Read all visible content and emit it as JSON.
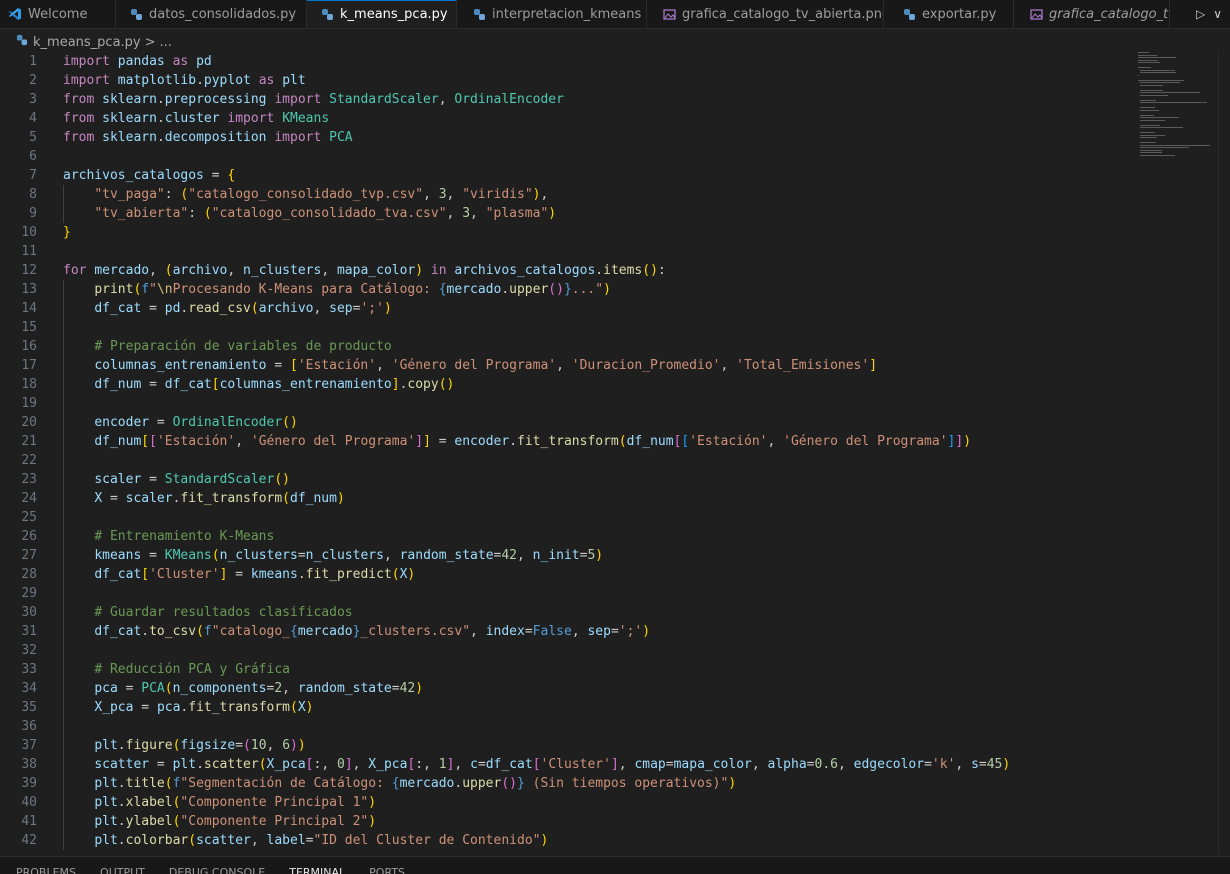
{
  "tabs": [
    {
      "label": "Welcome",
      "icon": "vscode-logo-icon"
    },
    {
      "label": "datos_consolidados.py",
      "icon": "python-icon"
    },
    {
      "label": "k_means_pca.py",
      "icon": "python-icon",
      "active": true,
      "close": "×"
    },
    {
      "label": "interpretacion_kmeans",
      "icon": "python-icon"
    },
    {
      "label": "grafica_catalogo_tv_abierta.png",
      "icon": "image-icon"
    },
    {
      "label": "exportar.py",
      "icon": "python-icon"
    },
    {
      "label": "grafica_catalogo_tv_p",
      "icon": "image-icon",
      "italic": true
    }
  ],
  "breadcrumb": {
    "file": "k_means_pca.py",
    "sep": ">",
    "rest": "..."
  },
  "tab_actions": {
    "run": "▷",
    "dropdown": "∨"
  },
  "panel": {
    "tabs": [
      "PROBLEMS",
      "OUTPUT",
      "DEBUG CONSOLE",
      "TERMINAL",
      "PORTS"
    ],
    "active": "TERMINAL"
  },
  "code": [
    {
      "n": "1",
      "t": "import pandas as pd"
    },
    {
      "n": "2",
      "t": "import matplotlib.pyplot as plt"
    },
    {
      "n": "3",
      "t": "from sklearn.preprocessing import StandardScaler, OrdinalEncoder"
    },
    {
      "n": "4",
      "t": "from sklearn.cluster import KMeans"
    },
    {
      "n": "5",
      "t": "from sklearn.decomposition import PCA"
    },
    {
      "n": "6",
      "t": ""
    },
    {
      "n": "7",
      "t": "archivos_catalogos = {"
    },
    {
      "n": "8",
      "t": "    \"tv_paga\": (\"catalogo_consolidado_tvp.csv\", 3, \"viridis\"),"
    },
    {
      "n": "9",
      "t": "    \"tv_abierta\": (\"catalogo_consolidado_tva.csv\", 3, \"plasma\")"
    },
    {
      "n": "10",
      "t": "}"
    },
    {
      "n": "11",
      "t": ""
    },
    {
      "n": "12",
      "t": "for mercado, (archivo, n_clusters, mapa_color) in archivos_catalogos.items():"
    },
    {
      "n": "13",
      "t": "    print(f\"\\nProcesando K-Means para Catálogo: {mercado.upper()}...\")"
    },
    {
      "n": "14",
      "t": "    df_cat = pd.read_csv(archivo, sep=';')"
    },
    {
      "n": "15",
      "t": ""
    },
    {
      "n": "16",
      "t": "    # Preparación de variables de producto"
    },
    {
      "n": "17",
      "t": "    columnas_entrenamiento = ['Estación', 'Género del Programa', 'Duracion_Promedio', 'Total_Emisiones']"
    },
    {
      "n": "18",
      "t": "    df_num = df_cat[columnas_entrenamiento].copy()"
    },
    {
      "n": "19",
      "t": ""
    },
    {
      "n": "20",
      "t": "    encoder = OrdinalEncoder()"
    },
    {
      "n": "21",
      "t": "    df_num[['Estación', 'Género del Programa']] = encoder.fit_transform(df_num[['Estación', 'Género del Programa']])"
    },
    {
      "n": "22",
      "t": ""
    },
    {
      "n": "23",
      "t": "    scaler = StandardScaler()"
    },
    {
      "n": "24",
      "t": "    X = scaler.fit_transform(df_num)"
    },
    {
      "n": "25",
      "t": ""
    },
    {
      "n": "26",
      "t": "    # Entrenamiento K-Means"
    },
    {
      "n": "27",
      "t": "    kmeans = KMeans(n_clusters=n_clusters, random_state=42, n_init=5)"
    },
    {
      "n": "28",
      "t": "    df_cat['Cluster'] = kmeans.fit_predict(X)"
    },
    {
      "n": "29",
      "t": ""
    },
    {
      "n": "30",
      "t": "    # Guardar resultados clasificados"
    },
    {
      "n": "31",
      "t": "    df_cat.to_csv(f\"catalogo_{mercado}_clusters.csv\", index=False, sep=';')"
    },
    {
      "n": "32",
      "t": ""
    },
    {
      "n": "33",
      "t": "    # Reducción PCA y Gráfica"
    },
    {
      "n": "34",
      "t": "    pca = PCA(n_components=2, random_state=42)"
    },
    {
      "n": "35",
      "t": "    X_pca = pca.fit_transform(X)"
    },
    {
      "n": "36",
      "t": ""
    },
    {
      "n": "37",
      "t": "    plt.figure(figsize=(10, 6))"
    },
    {
      "n": "38",
      "t": "    scatter = plt.scatter(X_pca[:, 0], X_pca[:, 1], c=df_cat['Cluster'], cmap=mapa_color, alpha=0.6, edgecolor='k', s=45)"
    },
    {
      "n": "39",
      "t": "    plt.title(f\"Segmentación de Catálogo: {mercado.upper()} (Sin tiempos operativos)\")"
    },
    {
      "n": "40",
      "t": "    plt.xlabel(\"Componente Principal 1\")"
    },
    {
      "n": "41",
      "t": "    plt.ylabel(\"Componente Principal 2\")"
    },
    {
      "n": "42",
      "t": "    plt.colorbar(scatter, label=\"ID del Cluster de Contenido\")"
    }
  ]
}
